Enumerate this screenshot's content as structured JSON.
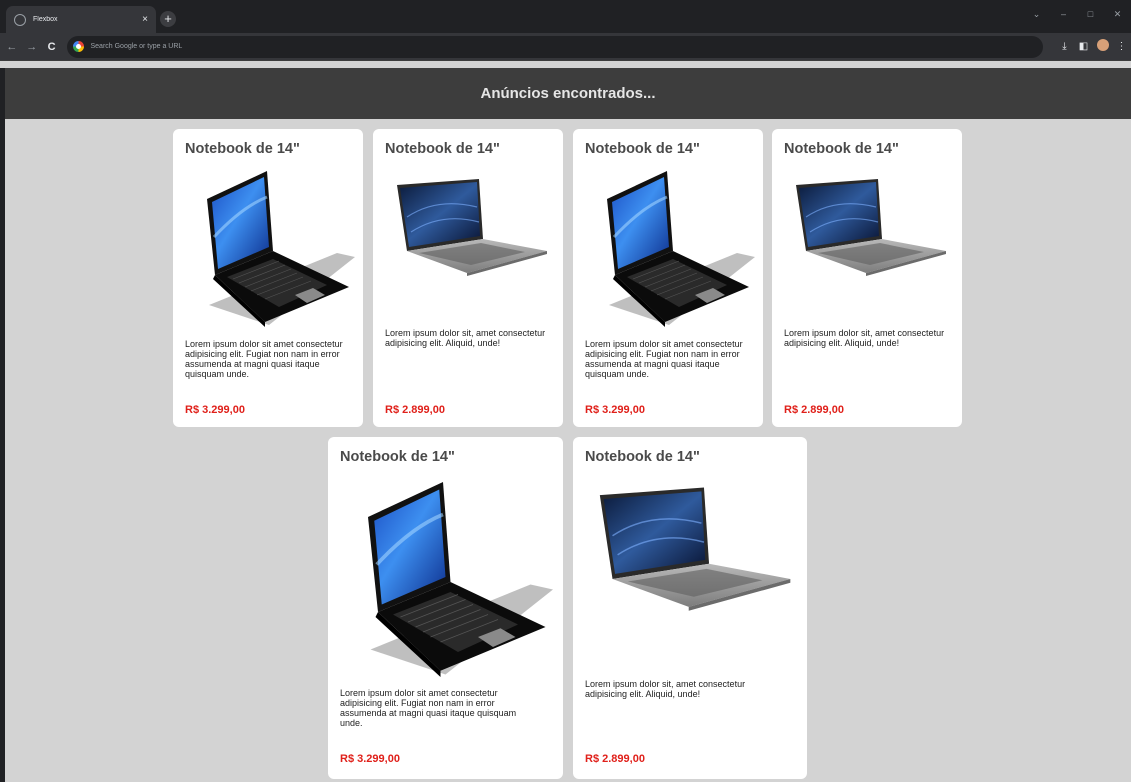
{
  "browser": {
    "tab_title": "Flexbox",
    "tab_close": "×",
    "new_tab": "+",
    "omnibox_placeholder": "Search Google or type a URL",
    "back": "←",
    "forward": "→",
    "reload": "C",
    "win_minimize": "–",
    "win_maximize": "□",
    "win_close": "✕",
    "win_dropdown": "⌄",
    "download": "⤓",
    "sidepanel": "◧",
    "menu": "⋮"
  },
  "header": {
    "title": "Anúncios encontrados..."
  },
  "products": [
    {
      "title": "Notebook de 14\"",
      "image": "black-laptop",
      "description": "Lorem ipsum dolor sit amet consectetur adipisicing elit. Fugiat non nam in error assumenda at magni quasi itaque quisquam unde.",
      "price": "R$ 3.299,00"
    },
    {
      "title": "Notebook de 14\"",
      "image": "silver-laptop",
      "description": "Lorem ipsum dolor sit, amet consectetur adipisicing elit. Aliquid, unde!",
      "price": "R$ 2.899,00"
    },
    {
      "title": "Notebook de 14\"",
      "image": "black-laptop",
      "description": "Lorem ipsum dolor sit amet consectetur adipisicing elit. Fugiat non nam in error assumenda at magni quasi itaque quisquam unde.",
      "price": "R$ 3.299,00"
    },
    {
      "title": "Notebook de 14\"",
      "image": "silver-laptop",
      "description": "Lorem ipsum dolor sit, amet consectetur adipisicing elit. Aliquid, unde!",
      "price": "R$ 2.899,00"
    },
    {
      "title": "Notebook de 14\"",
      "image": "black-laptop",
      "description": "Lorem ipsum dolor sit amet consectetur adipisicing elit. Fugiat non nam in error assumenda at magni quasi itaque quisquam unde.",
      "price": "R$ 3.299,00"
    },
    {
      "title": "Notebook de 14\"",
      "image": "silver-laptop",
      "description": "Lorem ipsum dolor sit, amet consectetur adipisicing elit. Aliquid, unde!",
      "price": "R$ 2.899,00"
    }
  ],
  "colors": {
    "price": "#e0201a",
    "header_bg": "#3d3d3d",
    "page_bg": "#d3d3d3"
  }
}
